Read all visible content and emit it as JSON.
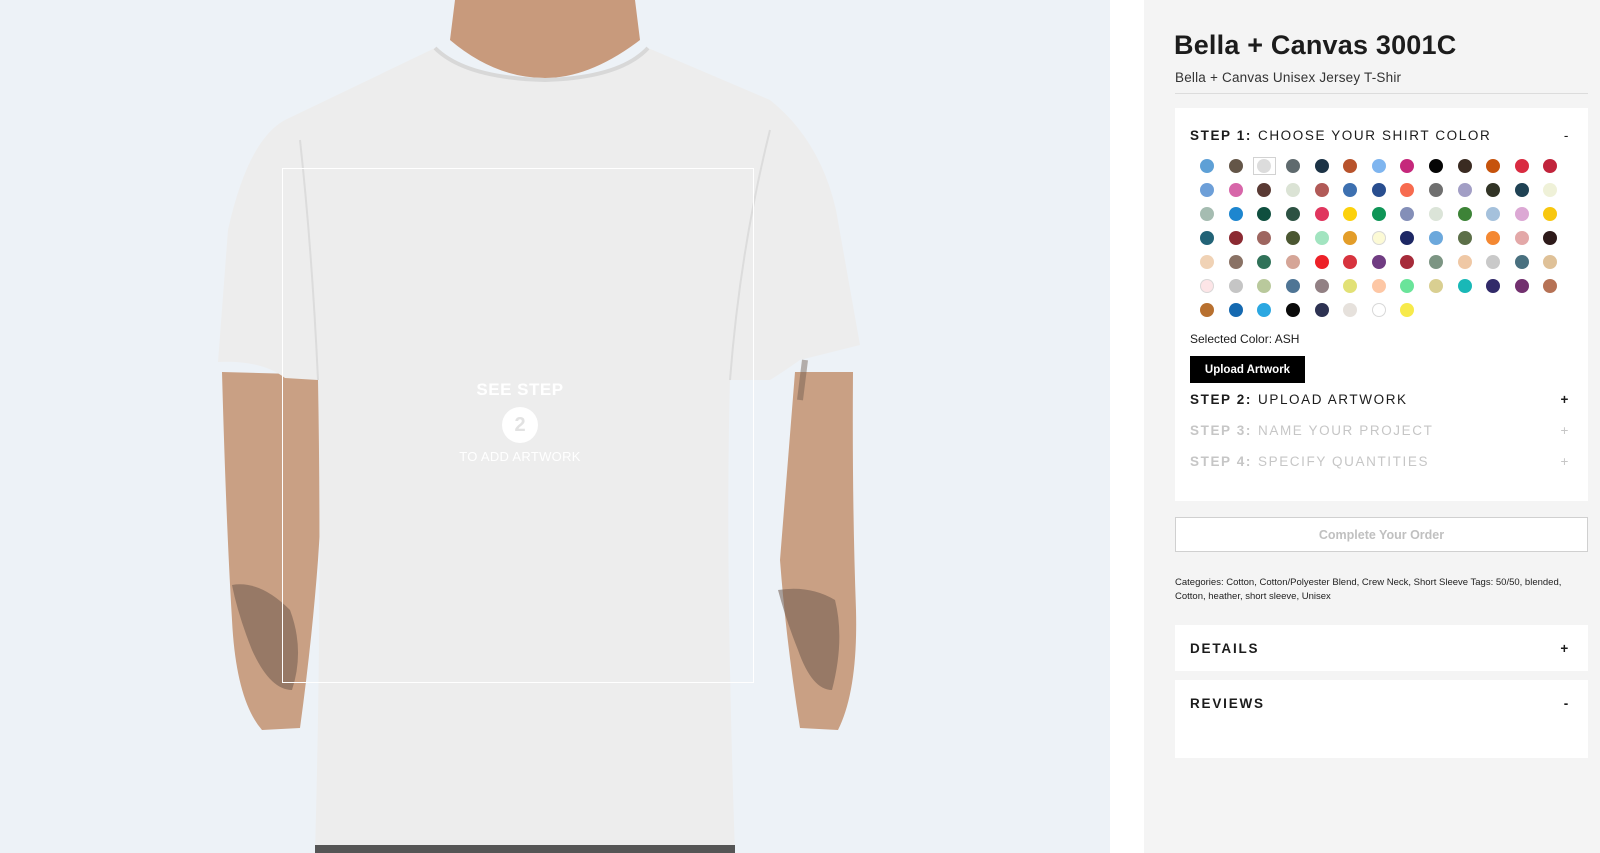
{
  "product": {
    "title": "Bella + Canvas 3001C",
    "subtitle": "Bella + Canvas Unisex Jersey T-Shir"
  },
  "preview": {
    "hint_top": "SEE STEP",
    "hint_number": "2",
    "hint_bottom": "TO ADD ARTWORK",
    "shirt_color": "#ededed"
  },
  "steps": {
    "step1": {
      "label": "STEP 1:",
      "text": "CHOOSE YOUR SHIRT COLOR",
      "toggle": "-"
    },
    "step2": {
      "label": "STEP 2:",
      "text": "UPLOAD ARTWORK",
      "toggle": "+"
    },
    "step3": {
      "label": "STEP 3:",
      "text": "NAME YOUR PROJECT",
      "toggle": "+"
    },
    "step4": {
      "label": "STEP 4:",
      "text": "SPECIFY QUANTITIES",
      "toggle": "+"
    }
  },
  "swatches": [
    "#5ea0d6",
    "#645648",
    "#dcdcdc",
    "#5f6a6e",
    "#1c3346",
    "#b8532c",
    "#7fb5ef",
    "#c5287b",
    "#050505",
    "#3a2b22",
    "#c6530c",
    "#d92b41",
    "#c1243c",
    "#6d9fd8",
    "#d766a9",
    "#5a3a34",
    "#dbe3d5",
    "#b15a57",
    "#3d70b0",
    "#294e8f",
    "#f76b4f",
    "#6f6f6f",
    "#a29ec5",
    "#323426",
    "#1f4254",
    "#eff1d8",
    "#a5bcb1",
    "#1d86cf",
    "#0f4f3f",
    "#2d5243",
    "#e0365e",
    "#fcd10c",
    "#0f9557",
    "#848fb8",
    "#dbe4d8",
    "#3d8337",
    "#a5c1dc",
    "#dca8d4",
    "#f8c70f",
    "#226377",
    "#8b2a32",
    "#9e6660",
    "#4b5732",
    "#a2e4c0",
    "#e39d29",
    "#fcfad5",
    "#1d2764",
    "#6ca8dc",
    "#5c6f48",
    "#f48832",
    "#e3a8a8",
    "#2e1a1a",
    "#f0d2b5",
    "#8a7265",
    "#307259",
    "#d5a597",
    "#ed2128",
    "#d7333e",
    "#703c82",
    "#a62b3a",
    "#7c9583",
    "#efc8a5",
    "#c9c9c9",
    "#49707f",
    "#dfc198",
    "#fde5e7",
    "#c5c5c5",
    "#b9c99c",
    "#4f7595",
    "#928084",
    "#e2e176",
    "#fdc7a5",
    "#6ae49a",
    "#d9cf91",
    "#19b8b7",
    "#312a69",
    "#72306f",
    "#b67255",
    "#b8702f",
    "#1569b0",
    "#2ba7e1",
    "#0a0a0a",
    "#2d3252",
    "#e6e1dc",
    "#ffffff",
    "#f7ea4b"
  ],
  "selected_color": "Selected Color: ASH",
  "upload_button": "Upload Artwork",
  "complete_button": "Complete Your Order",
  "categories_text": "Categories: Cotton, Cotton/Polyester Blend, Crew Neck, Short Sleeve Tags: 50/50, blended, Cotton, heather, short sleeve, Unisex",
  "details": {
    "label": "DETAILS",
    "toggle": "+"
  },
  "reviews": {
    "label": "REVIEWS",
    "toggle": "-"
  }
}
